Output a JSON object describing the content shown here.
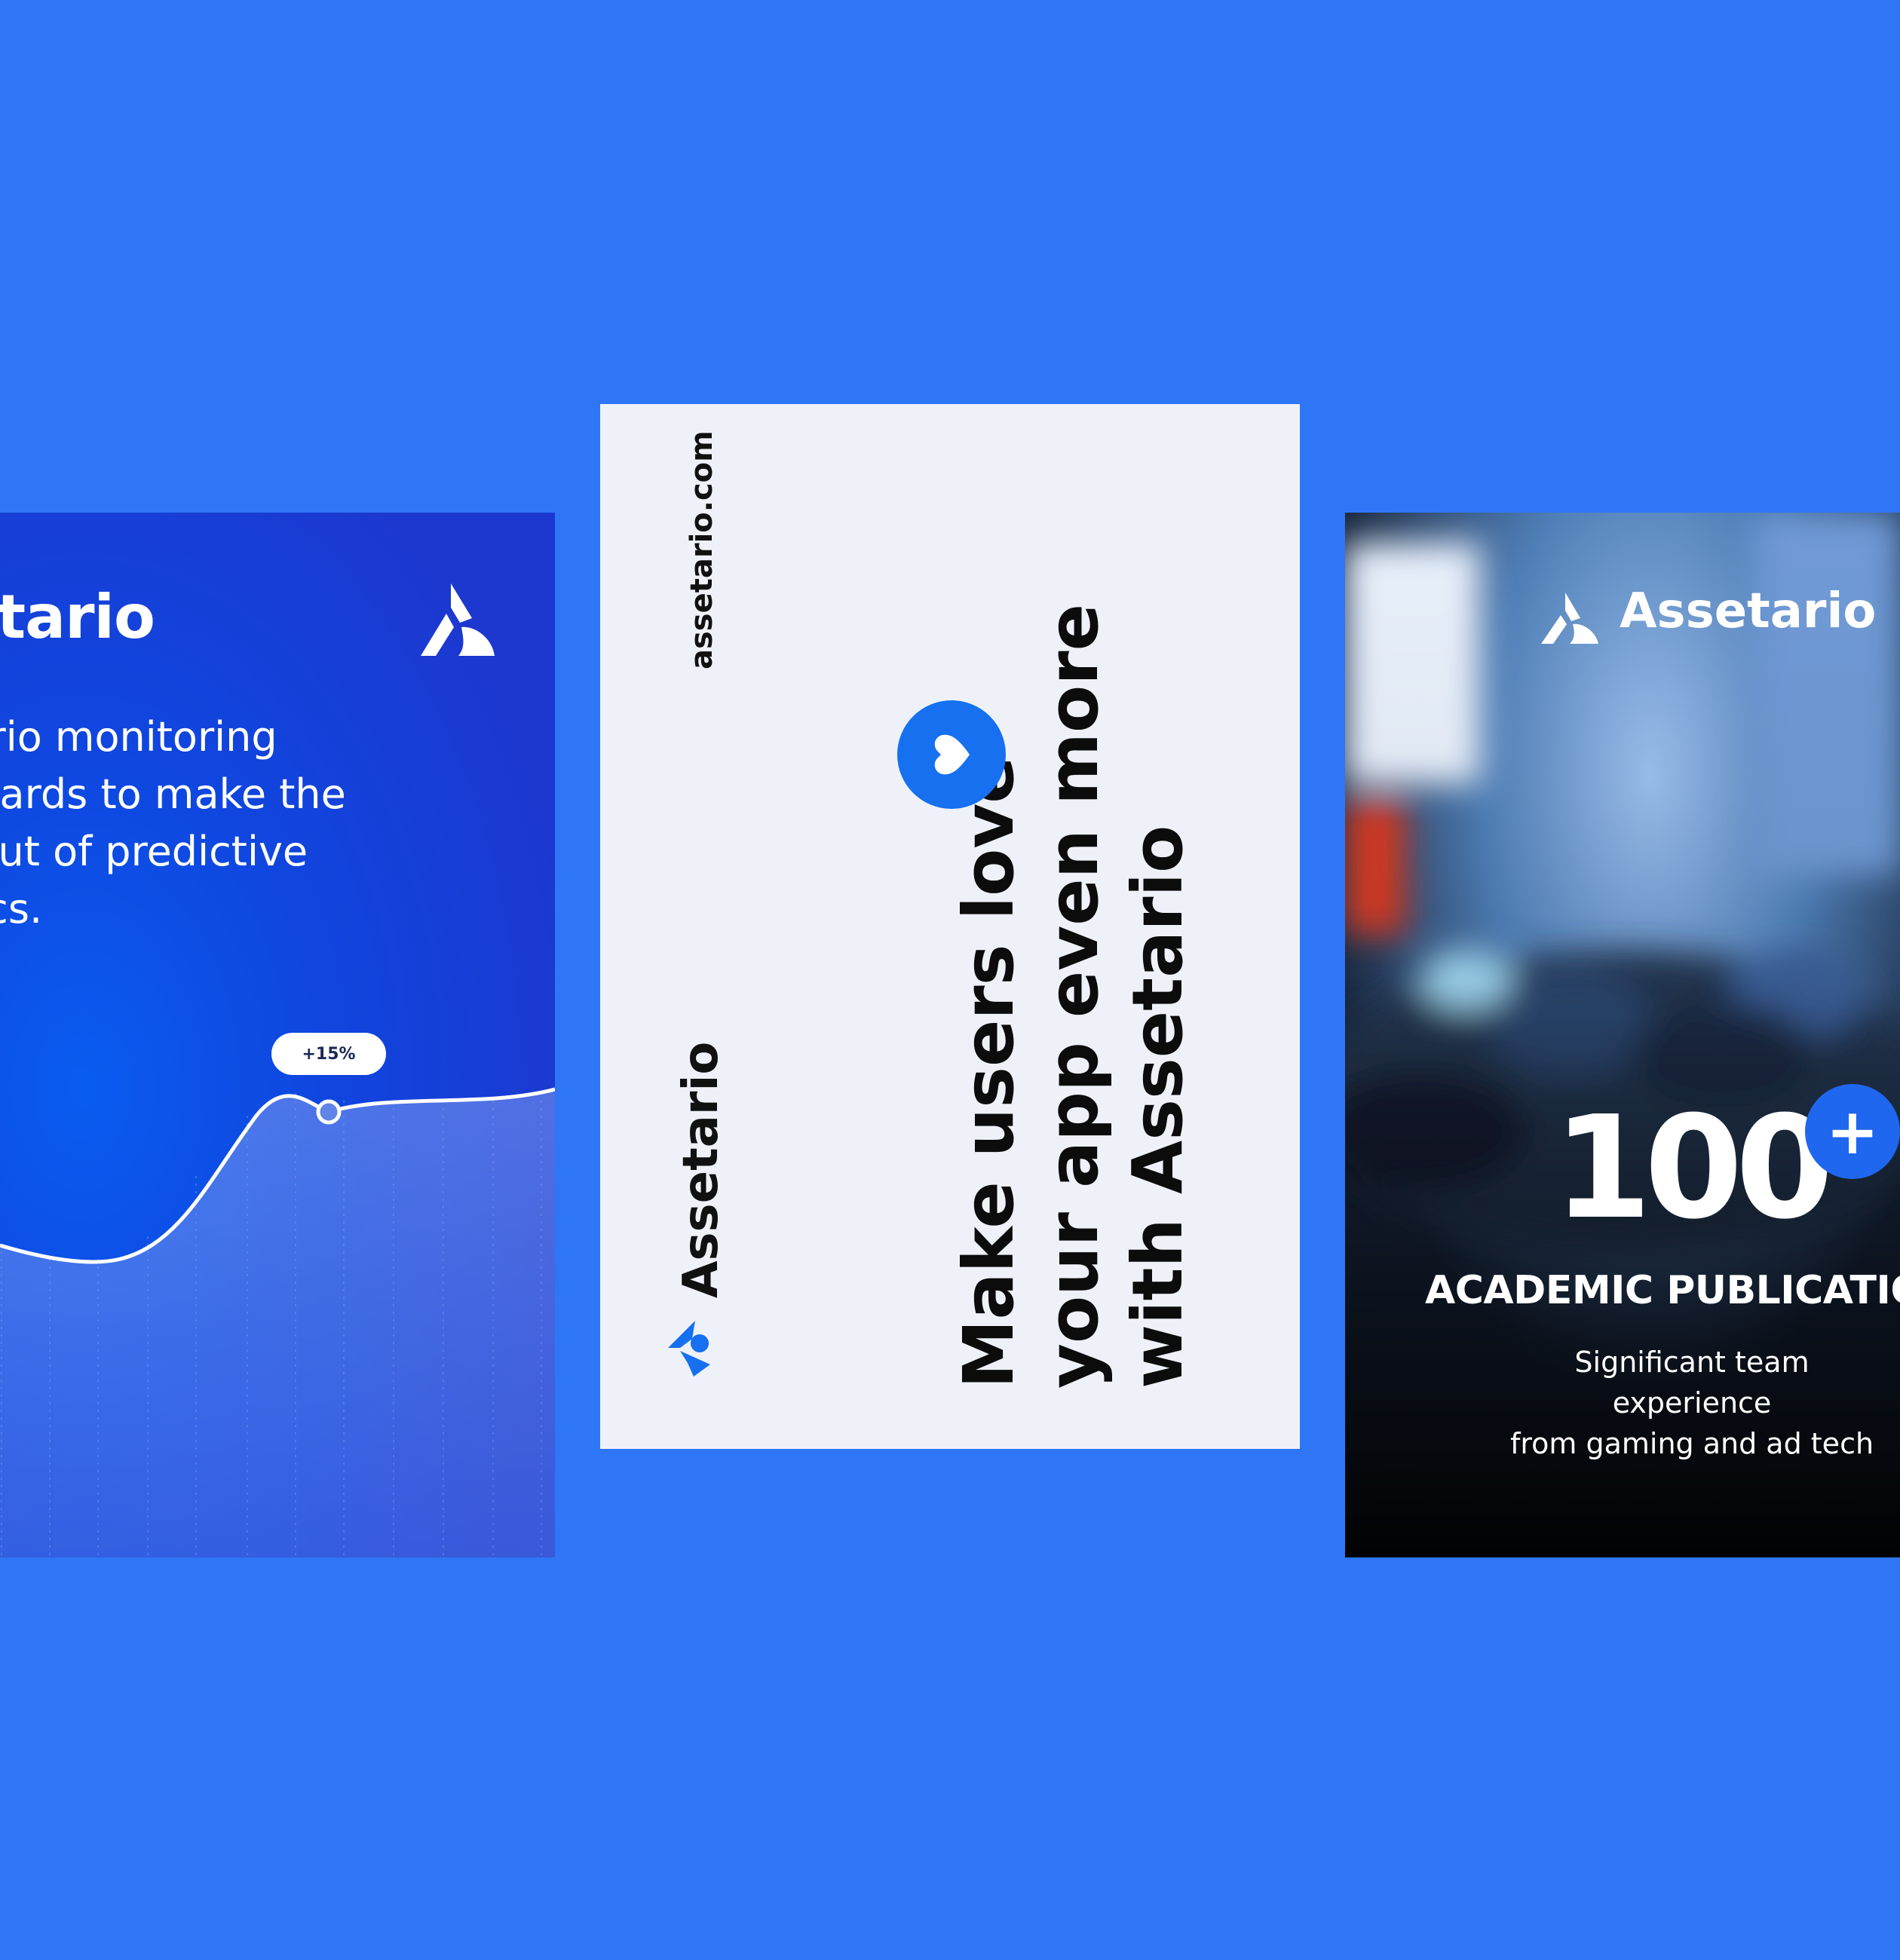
{
  "colors": {
    "background": "#2E76F5",
    "brand_blue": "#1670F0",
    "white_card": "#EEF2F8"
  },
  "left_card": {
    "brand": "setario",
    "logo_icon": "assetario-logo-icon",
    "copy": "etario monitoring\nhboards to make the\nst out of predictive\nlytics.",
    "badge": "+15%"
  },
  "middle_card": {
    "url": "assetario.com",
    "wordmark": "Assetario",
    "headline": "Make users love\nyour app even more\nwith Assetario",
    "badge_icon": "heart-icon"
  },
  "right_card": {
    "brand": "Assetario",
    "number": "100",
    "plus": "+",
    "heading": "ACADEMIC PUBLICATIO",
    "subtext": "Significant team experience\nfrom gaming and ad tech"
  }
}
